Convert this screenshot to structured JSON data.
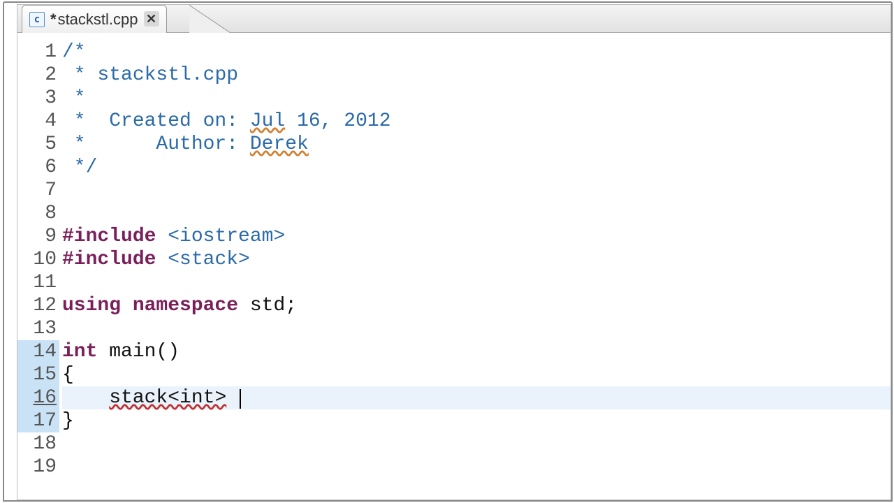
{
  "tab": {
    "icon_letter": "c",
    "dirty_marker": "*",
    "filename": "stackstl.cpp",
    "close_glyph": "✕"
  },
  "editor": {
    "current_line": 16,
    "highlight_start": 14,
    "highlight_end": 17,
    "lines": [
      {
        "n": 1,
        "tokens": [
          {
            "t": "/*",
            "c": "cm"
          }
        ]
      },
      {
        "n": 2,
        "tokens": [
          {
            "t": " * ",
            "c": "cm"
          },
          {
            "t": "stackstl.cpp",
            "c": "cm"
          }
        ]
      },
      {
        "n": 3,
        "tokens": [
          {
            "t": " *",
            "c": "cm"
          }
        ]
      },
      {
        "n": 4,
        "tokens": [
          {
            "t": " *  Created on: ",
            "c": "cm"
          },
          {
            "t": "Jul",
            "c": "cm spell"
          },
          {
            "t": " 16, 2012",
            "c": "cm"
          }
        ]
      },
      {
        "n": 5,
        "tokens": [
          {
            "t": " *      Author: ",
            "c": "cm"
          },
          {
            "t": "Derek",
            "c": "cm spell"
          }
        ]
      },
      {
        "n": 6,
        "tokens": [
          {
            "t": " */",
            "c": "cm"
          }
        ]
      },
      {
        "n": 7,
        "tokens": []
      },
      {
        "n": 8,
        "tokens": []
      },
      {
        "n": 9,
        "tokens": [
          {
            "t": "#include ",
            "c": "kw"
          },
          {
            "t": "<iostream>",
            "c": "inc"
          }
        ]
      },
      {
        "n": 10,
        "tokens": [
          {
            "t": "#include ",
            "c": "kw"
          },
          {
            "t": "<stack>",
            "c": "inc"
          }
        ]
      },
      {
        "n": 11,
        "tokens": []
      },
      {
        "n": 12,
        "tokens": [
          {
            "t": "using namespace ",
            "c": "kw"
          },
          {
            "t": "std;",
            "c": ""
          }
        ]
      },
      {
        "n": 13,
        "tokens": []
      },
      {
        "n": 14,
        "tokens": [
          {
            "t": "int ",
            "c": "kw"
          },
          {
            "t": "main()",
            "c": ""
          }
        ]
      },
      {
        "n": 15,
        "tokens": [
          {
            "t": "{",
            "c": ""
          }
        ]
      },
      {
        "n": 16,
        "tokens": [
          {
            "t": "    ",
            "c": ""
          },
          {
            "t": "stack<int>",
            "c": "err-under"
          },
          {
            "t": " ",
            "c": ""
          }
        ],
        "cursor": true,
        "warn": true
      },
      {
        "n": 17,
        "tokens": [
          {
            "t": "}",
            "c": ""
          }
        ]
      },
      {
        "n": 18,
        "tokens": []
      },
      {
        "n": 19,
        "tokens": []
      }
    ]
  }
}
